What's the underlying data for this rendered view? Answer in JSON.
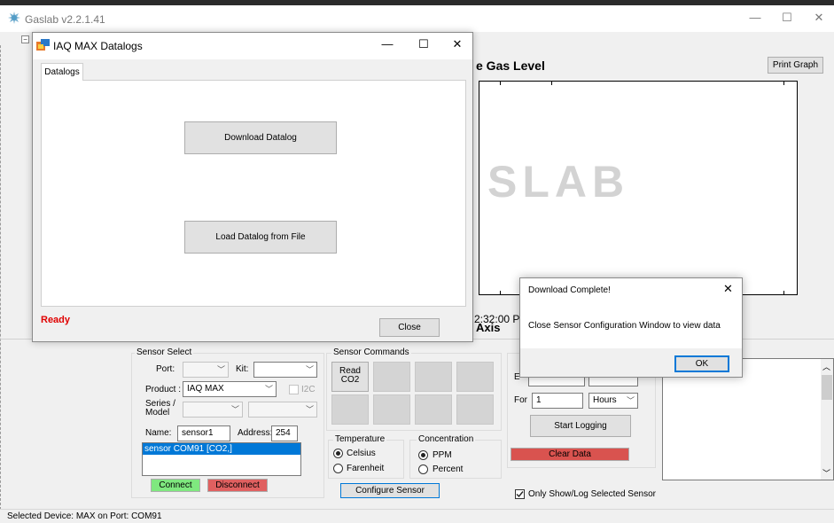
{
  "main_window": {
    "title": "Gaslab v2.2.1.41",
    "minimize": "—",
    "maximize": "☐",
    "close": "✕",
    "tree_toggle": "−"
  },
  "graph": {
    "title": "e Gas Level",
    "print_button": "Print Graph",
    "watermark": "SLAB",
    "time_label": "2:32:00 P",
    "axis_label": "Axis"
  },
  "sensor_select": {
    "group_label": "Sensor Select",
    "port_label": "Port:",
    "port_value": "",
    "kit_label": "Kit:",
    "kit_value": "",
    "product_label": "Product :",
    "product_value": "IAQ MAX",
    "i2c_label": "I2C",
    "series_label_line1": "Series /",
    "series_label_line2": "Model",
    "name_label": "Name:",
    "name_value": "sensor1",
    "address_label": "Address:",
    "address_value": "254",
    "list_items": [
      "sensor COM91 [CO2,]"
    ],
    "connect": "Connect",
    "disconnect": "Disconnect"
  },
  "sensor_commands": {
    "group_label": "Sensor Commands",
    "read_co2_line1": "Read",
    "read_co2_line2": "CO2"
  },
  "temperature": {
    "group_label": "Temperature",
    "celsius": "Celsius",
    "farenheit": "Farenheit"
  },
  "concentration": {
    "group_label": "Concentration",
    "ppm": "PPM",
    "percent": "Percent"
  },
  "configure_sensor": "Configure Sensor",
  "logging": {
    "every_label": "E",
    "for_label": "For",
    "for_value": "1",
    "unit_value": "Hours",
    "start_logging": "Start Logging",
    "clear_data": "Clear Data",
    "only_show": "Only Show/Log Selected Sensor"
  },
  "status_bar": "Selected Device: MAX on Port: COM91",
  "datalog_dialog": {
    "title": "IAQ MAX Datalogs",
    "minimize": "—",
    "maximize": "☐",
    "close": "✕",
    "tab": "Datalogs",
    "download_button": "Download Datalog",
    "load_button": "Load Datalog from File",
    "status": "Ready",
    "close_button": "Close"
  },
  "message_box": {
    "title": "Download Complete!",
    "close": "✕",
    "message": "Close Sensor Configuration Window to view data",
    "ok": "OK"
  },
  "colors": {
    "connect_bg": "#7fe87f",
    "disconnect_bg": "#e06060",
    "clear_data_bg": "#d9534f",
    "ready_text": "#e00000",
    "selection": "#0078d7"
  }
}
